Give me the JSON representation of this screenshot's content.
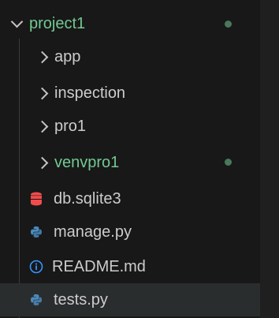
{
  "explorer": {
    "root": {
      "label": "project1",
      "expanded": true,
      "git_status": "untracked"
    },
    "folders": [
      {
        "label": "app"
      },
      {
        "label": "inspection"
      },
      {
        "label": "pro1"
      },
      {
        "label": "venvpro1",
        "git_status": "untracked"
      }
    ],
    "files": [
      {
        "label": "db.sqlite3",
        "icon": "database-icon"
      },
      {
        "label": "manage.py",
        "icon": "python-icon"
      },
      {
        "label": "README.md",
        "icon": "info-icon"
      },
      {
        "label": "tests.py",
        "icon": "python-icon",
        "selected": true
      }
    ]
  },
  "colors": {
    "background": "#181818",
    "text": "#cccccc",
    "untracked": "#73c991",
    "database": "#f14c4c",
    "python": "#4b8bbe",
    "info": "#3794ff",
    "selected_row": "#2a2d2e"
  }
}
